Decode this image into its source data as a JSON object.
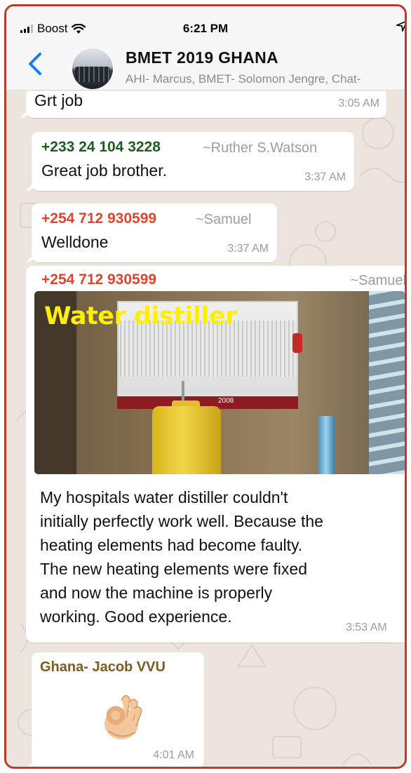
{
  "status_bar": {
    "carrier": "Boost",
    "time": "6:21 PM"
  },
  "header": {
    "title": "BMET 2019 GHANA",
    "subtitle": "AHI- Marcus, BMET- Solomon Jengre, Chat-"
  },
  "messages": [
    {
      "text": "Grt job",
      "time": "3:05 AM"
    },
    {
      "sender": "+233 24 104 3228",
      "alias": "~Ruther S.Watson",
      "text": "Great job brother.",
      "time": "3:37 AM",
      "sender_color": "#1b5e20"
    },
    {
      "sender": "+254 712 930599",
      "alias": "~Samuel",
      "text": "Welldone",
      "time": "3:37 AM",
      "sender_color": "#e0452b"
    },
    {
      "sender": "+254 712 930599",
      "alias": "~Samuel",
      "image_caption": "Water distiller",
      "image_label": "2008",
      "text_lines": [
        "My hospitals water distiller couldn't",
        "initially perfectly work well. Because the",
        "heating elements had become faulty.",
        "The new heating elements were fixed",
        "and now the machine is properly",
        "working. Good experience."
      ],
      "time": "3:53 AM",
      "sender_color": "#e0452b"
    },
    {
      "sender": "Ghana- Jacob VVU",
      "emoji": "ok-hand",
      "time": "4:01 AM",
      "sender_color": "#7a5c1e"
    }
  ],
  "colors": {
    "accent_blue": "#1a7cf5",
    "chat_background": "#ece5dd",
    "frame_border": "#c0392b"
  }
}
